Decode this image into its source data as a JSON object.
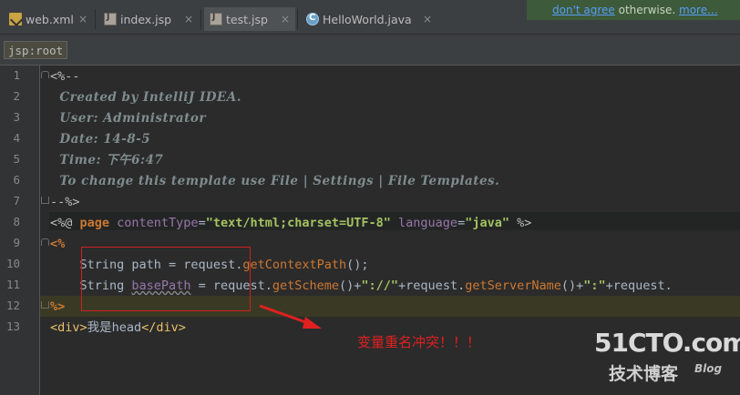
{
  "tabs": [
    {
      "label": "web.xml",
      "icon": "xml-file-icon",
      "active": false
    },
    {
      "label": "index.jsp",
      "icon": "jsp-file-icon",
      "active": false
    },
    {
      "label": "test.jsp",
      "icon": "jsp-file-icon",
      "active": true
    },
    {
      "label": "HelloWorld.java",
      "icon": "java-class-icon",
      "active": false
    }
  ],
  "tab_close": "×",
  "notification": {
    "link1": "don't agree",
    "middle": " otherwise. ",
    "link2": "more..."
  },
  "breadcrumb": "jsp:root",
  "line_numbers": [
    "1",
    "2",
    "3",
    "4",
    "5",
    "6",
    "7",
    "8",
    "9",
    "10",
    "11",
    "12",
    "13"
  ],
  "code": {
    "l1": "<%--",
    "l2": "  Created by IntelliJ IDEA.",
    "l3": "  User: Administrator",
    "l4": "  Date: 14-8-5",
    "l5": "  Time: 下午6:47",
    "l6": "  To change this template use File | Settings | File Templates.",
    "l7": "--%>",
    "l8": {
      "open": "<%@ ",
      "kw": "page ",
      "a1": "contentType",
      "eq1": "=",
      "v1": "\"text/html;charset=UTF-8\"",
      "a2": " language",
      "eq2": "=",
      "v2": "\"java\"",
      "close": " %>"
    },
    "l9": "<%",
    "l10": {
      "indent": "    ",
      "t1": "String path = request.",
      "m1": "getContextPath",
      "t2": "();"
    },
    "l11": {
      "indent": "    ",
      "t1": "String ",
      "var": "basePath",
      "t2": " = request.",
      "m1": "getScheme",
      "t3": "()+",
      "s1": "\"://\"",
      "t4": "+request.",
      "m2": "getServerName",
      "t5": "()+",
      "s2": "\":\"",
      "t6": "+request."
    },
    "l12": "%>",
    "l13": {
      "o": "<div>",
      "t": "我是head",
      "c": "</div>"
    }
  },
  "annotation": "变量重名冲突！！！",
  "watermark": {
    "site": "51CTO.com",
    "tagline": "技术博客",
    "blog": "Blog"
  },
  "colors": {
    "keyword": "#cc7832",
    "string": "#a5c261",
    "comment": "#7f8c8d",
    "annotation": "#e02020",
    "background": "#2b2b2b"
  }
}
